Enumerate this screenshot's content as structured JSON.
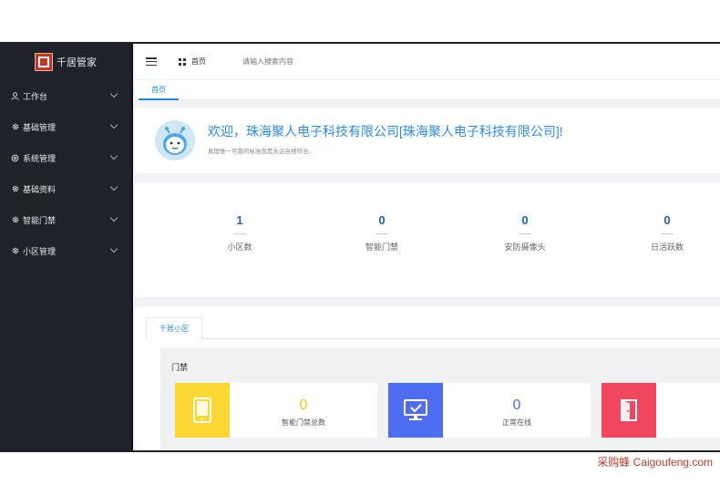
{
  "app": {
    "title": "千居管家",
    "brand_color": "#c0392b"
  },
  "sidebar": {
    "items": [
      {
        "label": "工作台",
        "icon": "user-icon"
      },
      {
        "label": "基础管理",
        "icon": "gear-icon"
      },
      {
        "label": "系统管理",
        "icon": "settings-icon"
      },
      {
        "label": "基础资料",
        "icon": "gear-icon"
      },
      {
        "label": "智能门禁",
        "icon": "gear-icon"
      },
      {
        "label": "小区管理",
        "icon": "gear-icon"
      }
    ]
  },
  "topbar": {
    "breadcrumb": "首页",
    "search_placeholder": "请输入搜索内容"
  },
  "tabs": {
    "active": "首页"
  },
  "welcome": {
    "title": "欢迎，珠海聚人电子科技有限公司[珠海聚人电子科技有限公司]!",
    "subtitle": "真理惟一可靠的标准就是永远自相符合。"
  },
  "stats": [
    {
      "value": "1",
      "label": "小区数"
    },
    {
      "value": "0",
      "label": "智能门禁"
    },
    {
      "value": "0",
      "label": "安防摄像头"
    },
    {
      "value": "0",
      "label": "日活跃数"
    }
  ],
  "panel": {
    "tab": "千居小区",
    "section_title": "门禁",
    "cards": [
      {
        "value": "0",
        "label": "智能门禁总数",
        "color": "#fad733",
        "value_color": "#f5c518",
        "icon": "tablet-icon"
      },
      {
        "value": "0",
        "label": "正常在线",
        "color": "#4e6ef2",
        "value_color": "#4e6ef2",
        "icon": "monitor-check-icon"
      },
      {
        "value": "",
        "label": "",
        "color": "#f0475e",
        "value_color": "#f0475e",
        "icon": "door-icon"
      }
    ]
  },
  "watermark": "采购蜂 Caigoufeng.com"
}
